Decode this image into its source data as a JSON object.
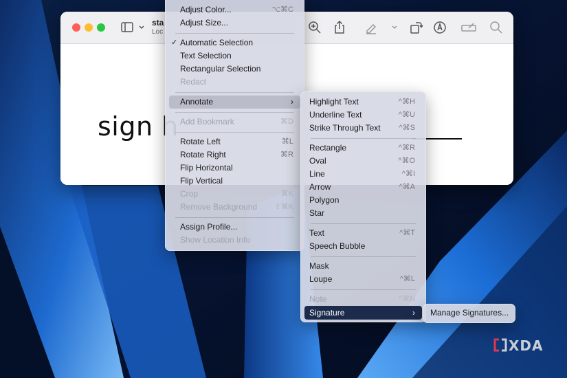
{
  "window": {
    "doc_title": "sta",
    "doc_subtitle": "Loc",
    "document_text": "sign h"
  },
  "main_menu": {
    "items": [
      {
        "label": "Adjust Color...",
        "shortcut": "⌥⌘C",
        "disabled": false
      },
      {
        "label": "Adjust Size...",
        "shortcut": "",
        "disabled": false
      },
      {
        "label": "Automatic Selection",
        "shortcut": "",
        "checked": true,
        "disabled": false
      },
      {
        "label": "Text Selection",
        "shortcut": "",
        "disabled": false
      },
      {
        "label": "Rectangular Selection",
        "shortcut": "",
        "disabled": false
      },
      {
        "label": "Redact",
        "shortcut": "",
        "disabled": true
      },
      {
        "label": "Annotate",
        "shortcut": "",
        "submenu": true,
        "disabled": false
      },
      {
        "label": "Add Bookmark",
        "shortcut": "⌘D",
        "disabled": true
      },
      {
        "label": "Rotate Left",
        "shortcut": "⌘L",
        "disabled": false
      },
      {
        "label": "Rotate Right",
        "shortcut": "⌘R",
        "disabled": false
      },
      {
        "label": "Flip Horizontal",
        "shortcut": "",
        "disabled": false
      },
      {
        "label": "Flip Vertical",
        "shortcut": "",
        "disabled": false
      },
      {
        "label": "Crop",
        "shortcut": "⌘K",
        "disabled": true
      },
      {
        "label": "Remove Background",
        "shortcut": "⇧⌘K",
        "disabled": true
      },
      {
        "label": "Assign Profile...",
        "shortcut": "",
        "disabled": false
      },
      {
        "label": "Show Location Info",
        "shortcut": "",
        "disabled": true
      }
    ],
    "checkmark": "✓",
    "chevron": "›"
  },
  "annotate_menu": {
    "items": [
      {
        "label": "Highlight Text",
        "shortcut": "^⌘H",
        "disabled": false
      },
      {
        "label": "Underline Text",
        "shortcut": "^⌘U",
        "disabled": false
      },
      {
        "label": "Strike Through Text",
        "shortcut": "^⌘S",
        "disabled": false
      },
      {
        "label": "Rectangle",
        "shortcut": "^⌘R",
        "disabled": false
      },
      {
        "label": "Oval",
        "shortcut": "^⌘O",
        "disabled": false
      },
      {
        "label": "Line",
        "shortcut": "^⌘I",
        "disabled": false
      },
      {
        "label": "Arrow",
        "shortcut": "^⌘A",
        "disabled": false
      },
      {
        "label": "Polygon",
        "shortcut": "",
        "disabled": false
      },
      {
        "label": "Star",
        "shortcut": "",
        "disabled": false
      },
      {
        "label": "Text",
        "shortcut": "^⌘T",
        "disabled": false
      },
      {
        "label": "Speech Bubble",
        "shortcut": "",
        "disabled": false
      },
      {
        "label": "Mask",
        "shortcut": "",
        "disabled": false
      },
      {
        "label": "Loupe",
        "shortcut": "^⌘L",
        "disabled": false
      },
      {
        "label": "Note",
        "shortcut": "^⌘N",
        "disabled": true
      },
      {
        "label": "Signature",
        "shortcut": "",
        "submenu": true,
        "disabled": false
      }
    ],
    "chevron": "›"
  },
  "signature_menu": {
    "items": [
      {
        "label": "Manage Signatures..."
      }
    ]
  },
  "watermark": {
    "text": "XDA",
    "accent_color": "#e0394f"
  },
  "colors": {
    "desktop_dark": "#06142e",
    "desktop_blue": "#1c6fd6",
    "highlight": "#1c2b4c"
  }
}
